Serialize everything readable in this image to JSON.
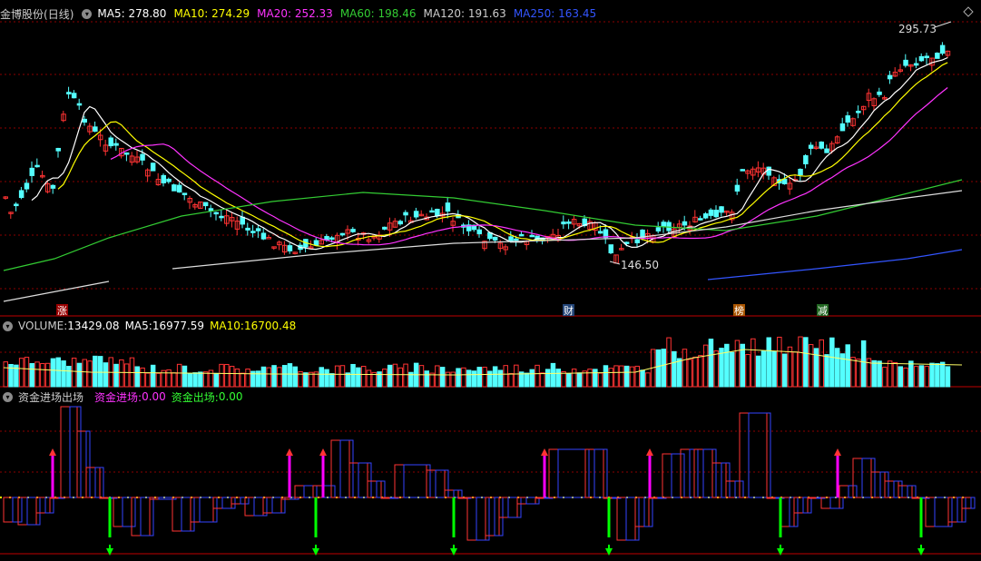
{
  "stock": {
    "name": "金博股份",
    "period": "(日线)"
  },
  "ma": [
    {
      "label": "MA5: ",
      "value": "278.80",
      "color": "#ffffff"
    },
    {
      "label": "MA10: ",
      "value": "274.29",
      "color": "#ffff00"
    },
    {
      "label": "MA20: ",
      "value": "252.33",
      "color": "#ff33ff"
    },
    {
      "label": "MA60: ",
      "value": "198.46",
      "color": "#33cc33"
    },
    {
      "label": "MA120: ",
      "value": "191.63",
      "color": "#cccccc"
    },
    {
      "label": "MA250: ",
      "value": "163.45",
      "color": "#3355ff"
    }
  ],
  "price_labels": {
    "high": "295.73",
    "low": "146.50"
  },
  "event_markers": [
    {
      "text": "涨",
      "bg": "#990000"
    },
    {
      "text": "财",
      "bg": "#224477"
    },
    {
      "text": "榜",
      "bg": "#aa5500"
    },
    {
      "text": "减",
      "bg": "#226622"
    }
  ],
  "volume": {
    "title": "VOLUME: ",
    "value": "13429.08",
    "ma5_label": "MA5: ",
    "ma5": "16977.59",
    "ma10_label": "MA10: ",
    "ma10": "16700.48"
  },
  "fund": {
    "title": "资金进场出场",
    "in_label": "资金进场: ",
    "in_value": "0.00",
    "out_label": "资金出场: ",
    "out_value": "0.00"
  },
  "colors": {
    "up": "#ff3333",
    "down": "#54ffff",
    "grid": "#8b0000",
    "in_arrow": "#ff00ff",
    "out_arrow": "#00ff00"
  }
}
